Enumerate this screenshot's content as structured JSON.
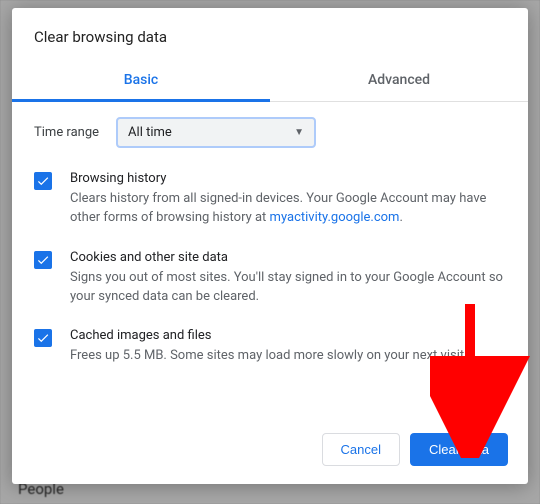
{
  "backdrop": {
    "people": "People"
  },
  "dialog": {
    "title": "Clear browsing data",
    "tabs": {
      "basic": "Basic",
      "advanced": "Advanced"
    },
    "time": {
      "label": "Time range",
      "selected": "All time"
    },
    "options": {
      "history": {
        "title": "Browsing history",
        "desc_before": "Clears history from all signed-in devices. Your Google Account may have other forms of browsing history at ",
        "link_text": "myactivity.google.com",
        "desc_after": "."
      },
      "cookies": {
        "title": "Cookies and other site data",
        "desc": "Signs you out of most sites. You'll stay signed in to your Google Account so your synced data can be cleared."
      },
      "cache": {
        "title": "Cached images and files",
        "desc": "Frees up 5.5 MB. Some sites may load more slowly on your next visit."
      }
    },
    "buttons": {
      "cancel": "Cancel",
      "clear": "Clear data"
    }
  }
}
